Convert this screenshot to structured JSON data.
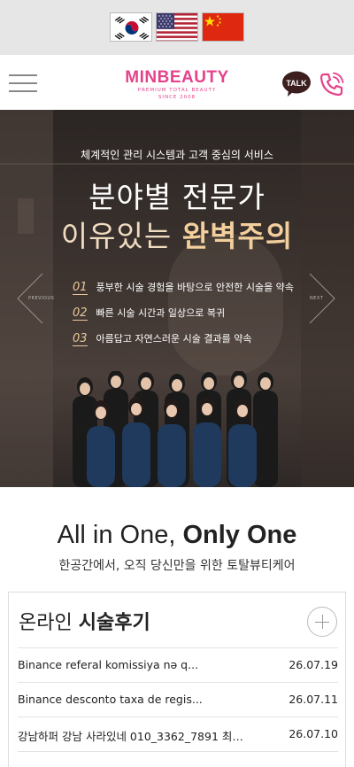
{
  "lang": {
    "korean": "Korean",
    "english": "English",
    "chinese": "Chinese"
  },
  "header": {
    "logo": "MINBEAUTY",
    "logo_sub1": "PREMIUM TOTAL BEAUTY",
    "logo_sub2": "SINCE 2008",
    "talk_label": "TALK"
  },
  "hero": {
    "caption": "체계적인 관리 시스템과 고객 중심의 서비스",
    "headline1": "분야별 전문가",
    "headline2_pre": "이유있는 ",
    "headline2_bold": "완벽주의",
    "features": [
      {
        "num": "01",
        "text": "풍부한 시술 경험을 바탕으로 안전한 시술을 약속"
      },
      {
        "num": "02",
        "text": "빠른 시술 시간과 일상으로 복귀"
      },
      {
        "num": "03",
        "text": "아름답고 자연스러운 시술 결과를 약속"
      }
    ],
    "prev_label": "PREVIOUS",
    "next_label": "NEXT"
  },
  "intro": {
    "title_light": "All in One, ",
    "title_bold": "Only One",
    "subtitle": "한공간에서, 오직 당신만을 위한 토탈뷰티케어"
  },
  "reviews": {
    "title_light": "온라인 ",
    "title_bold": "시술후기",
    "items": [
      {
        "title": "Binance referal komissiya nə q...",
        "date": "26.07.19"
      },
      {
        "title": "Binance desconto taxa de regis...",
        "date": "26.07.11"
      },
      {
        "title": "강남하퍼 강남 사라있네 010_3362_7891 최저...",
        "date": "26.07.10"
      }
    ]
  }
}
